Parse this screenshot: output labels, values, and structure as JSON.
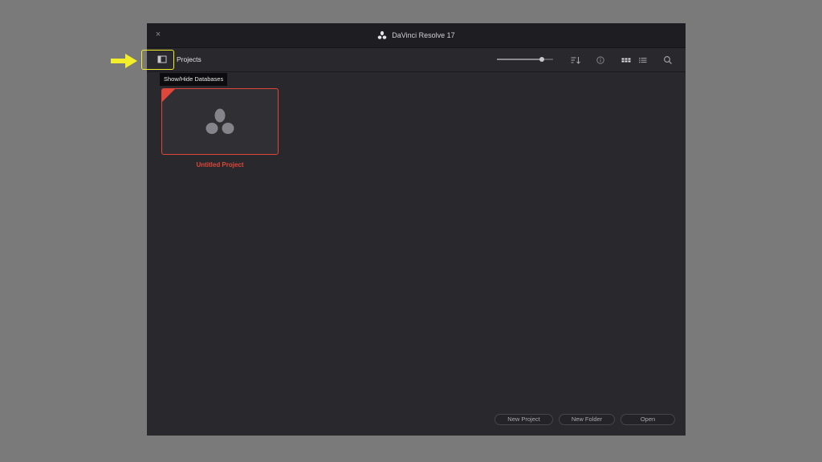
{
  "window": {
    "title": "DaVinci Resolve 17",
    "close_glyph": "×"
  },
  "toolbar": {
    "section_label": "Projects",
    "thumbnail_size": 0.8,
    "icons": [
      "database-panel-icon",
      "sort-icon",
      "info-icon",
      "grid-view-icon",
      "list-view-icon",
      "search-icon"
    ]
  },
  "tooltip": {
    "text": "Show/Hide Databases"
  },
  "project": {
    "name": "Untitled Project"
  },
  "footer": {
    "new_project": "New Project",
    "new_folder": "New Folder",
    "open": "Open"
  },
  "colors": {
    "background": "#7a7a7a",
    "window": "#28282d",
    "titlebar": "#1e1e22",
    "accent_red": "#e0473a",
    "highlight_yellow": "#f2ee2a"
  }
}
